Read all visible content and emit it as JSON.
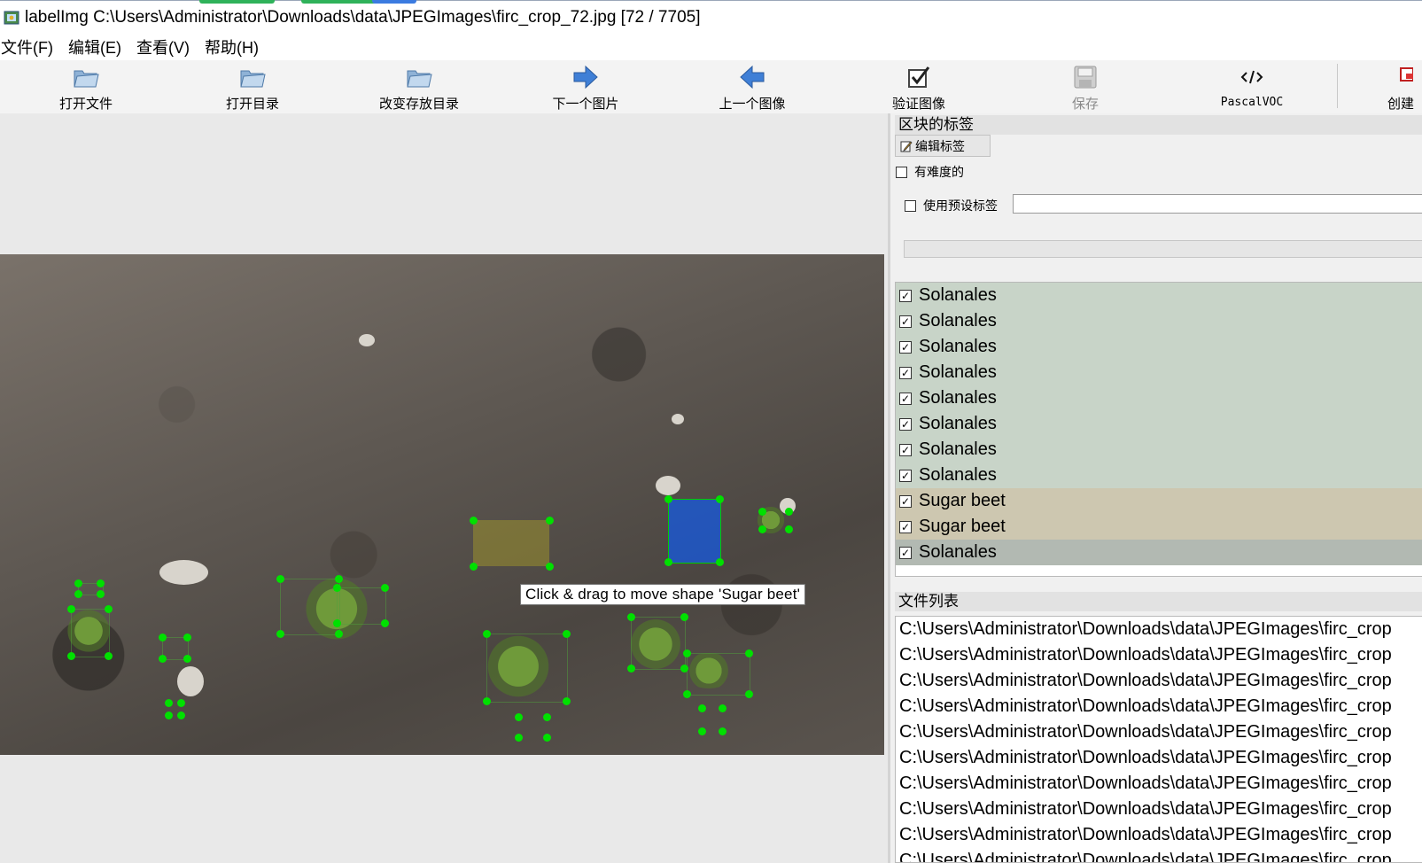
{
  "window": {
    "title": "labelImg C:\\Users\\Administrator\\Downloads\\data\\JPEGImages\\firc_crop_72.jpg [72 / 7705]"
  },
  "menu": [
    {
      "label": "文件(F)"
    },
    {
      "label": "编辑(E)"
    },
    {
      "label": "查看(V)"
    },
    {
      "label": "帮助(H)"
    }
  ],
  "toolbar": {
    "open_file": "打开文件",
    "open_dir": "打开目录",
    "change_save_dir": "改变存放目录",
    "next_image": "下一个图片",
    "prev_image": "上一个图像",
    "verify_image": "验证图像",
    "save": "保存",
    "format": "PascalVOC",
    "create": "创建"
  },
  "canvas": {
    "tooltip": "Click & drag to move shape 'Sugar beet'"
  },
  "labels_panel": {
    "title": "区块的标签",
    "edit_label_button": "编辑标签",
    "difficult": "有难度的",
    "use_default_label": "使用预设标签",
    "items": [
      {
        "label": "Solanales",
        "checked": true,
        "color": "#c8d4c8"
      },
      {
        "label": "Solanales",
        "checked": true,
        "color": "#c8d4c8"
      },
      {
        "label": "Solanales",
        "checked": true,
        "color": "#c8d4c8"
      },
      {
        "label": "Solanales",
        "checked": true,
        "color": "#c8d4c8"
      },
      {
        "label": "Solanales",
        "checked": true,
        "color": "#c8d4c8"
      },
      {
        "label": "Solanales",
        "checked": true,
        "color": "#c8d4c8"
      },
      {
        "label": "Solanales",
        "checked": true,
        "color": "#c8d4c8"
      },
      {
        "label": "Solanales",
        "checked": true,
        "color": "#c8d4c8"
      },
      {
        "label": "Sugar beet",
        "checked": true,
        "color": "#cdc7b0"
      },
      {
        "label": "Sugar beet",
        "checked": true,
        "color": "#cdc7b0"
      },
      {
        "label": "Solanales",
        "checked": true,
        "color": "#b2b9b2"
      }
    ]
  },
  "file_panel": {
    "title": "文件列表",
    "files": [
      "C:\\Users\\Administrator\\Downloads\\data\\JPEGImages\\firc_crop",
      "C:\\Users\\Administrator\\Downloads\\data\\JPEGImages\\firc_crop",
      "C:\\Users\\Administrator\\Downloads\\data\\JPEGImages\\firc_crop",
      "C:\\Users\\Administrator\\Downloads\\data\\JPEGImages\\firc_crop",
      "C:\\Users\\Administrator\\Downloads\\data\\JPEGImages\\firc_crop",
      "C:\\Users\\Administrator\\Downloads\\data\\JPEGImages\\firc_crop",
      "C:\\Users\\Administrator\\Downloads\\data\\JPEGImages\\firc_crop",
      "C:\\Users\\Administrator\\Downloads\\data\\JPEGImages\\firc_crop",
      "C:\\Users\\Administrator\\Downloads\\data\\JPEGImages\\firc_crop",
      "C:\\Users\\Administrator\\Downloads\\data\\JPEGImages\\firc_crop"
    ]
  },
  "colors": {
    "selected_shape": "#1e5adc",
    "shape_vertex": "#00e000",
    "solanales_row": "#c8d4c8",
    "sugar_beet_row": "#cdc7b0"
  }
}
